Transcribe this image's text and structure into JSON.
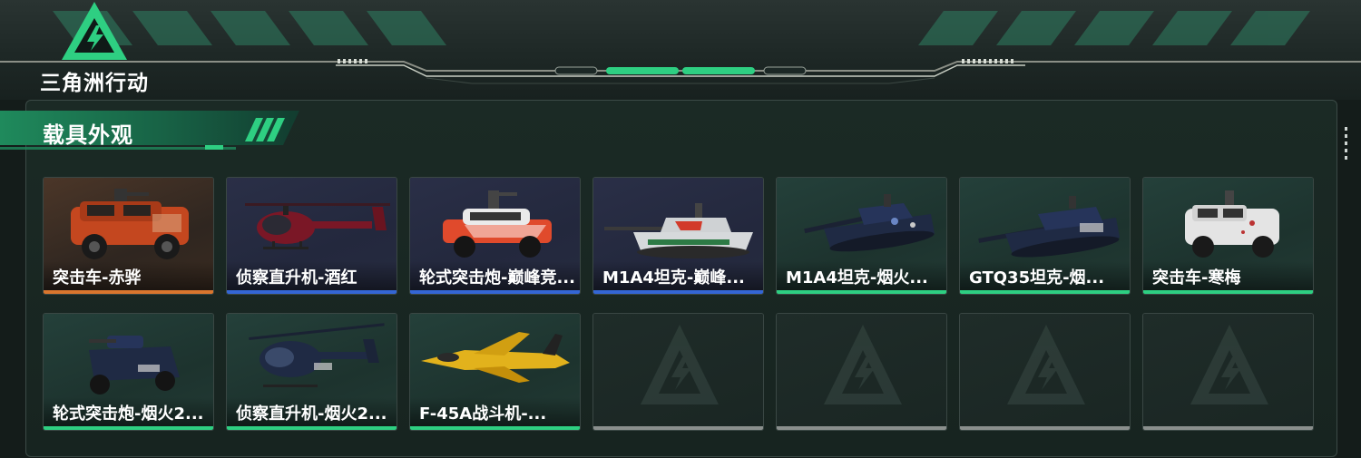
{
  "brand": {
    "name": "三角洲行动",
    "logo": "delta-force-triangle-logo"
  },
  "section": {
    "title": "载具外观"
  },
  "colors": {
    "accent": "#2ecf82",
    "orange": "#d9762e",
    "blue": "#3466d4",
    "empty": "#8a8f8d"
  },
  "vehicles": [
    {
      "name": "突击车-赤骅",
      "rarity": "orange",
      "icon": "armored-car-icon"
    },
    {
      "name": "侦察直升机-酒红",
      "rarity": "blue",
      "icon": "helicopter-icon"
    },
    {
      "name": "轮式突击炮-巅峰竞...",
      "rarity": "blue",
      "icon": "wheeled-assault-gun-icon"
    },
    {
      "name": "M1A4坦克-巅峰...",
      "rarity": "blue",
      "icon": "tank-icon"
    },
    {
      "name": "M1A4坦克-烟火...",
      "rarity": "green",
      "icon": "tank-icon"
    },
    {
      "name": "GTQ35坦克-烟...",
      "rarity": "green",
      "icon": "tank-icon"
    },
    {
      "name": "突击车-寒梅",
      "rarity": "green",
      "icon": "armored-car-icon"
    },
    {
      "name": "轮式突击炮-烟火2...",
      "rarity": "green",
      "icon": "wheeled-assault-gun-icon"
    },
    {
      "name": "侦察直升机-烟火2...",
      "rarity": "green",
      "icon": "helicopter-icon"
    },
    {
      "name": "F-45A战斗机-...",
      "rarity": "green",
      "icon": "fighter-jet-icon"
    }
  ],
  "empty_slots": 4
}
